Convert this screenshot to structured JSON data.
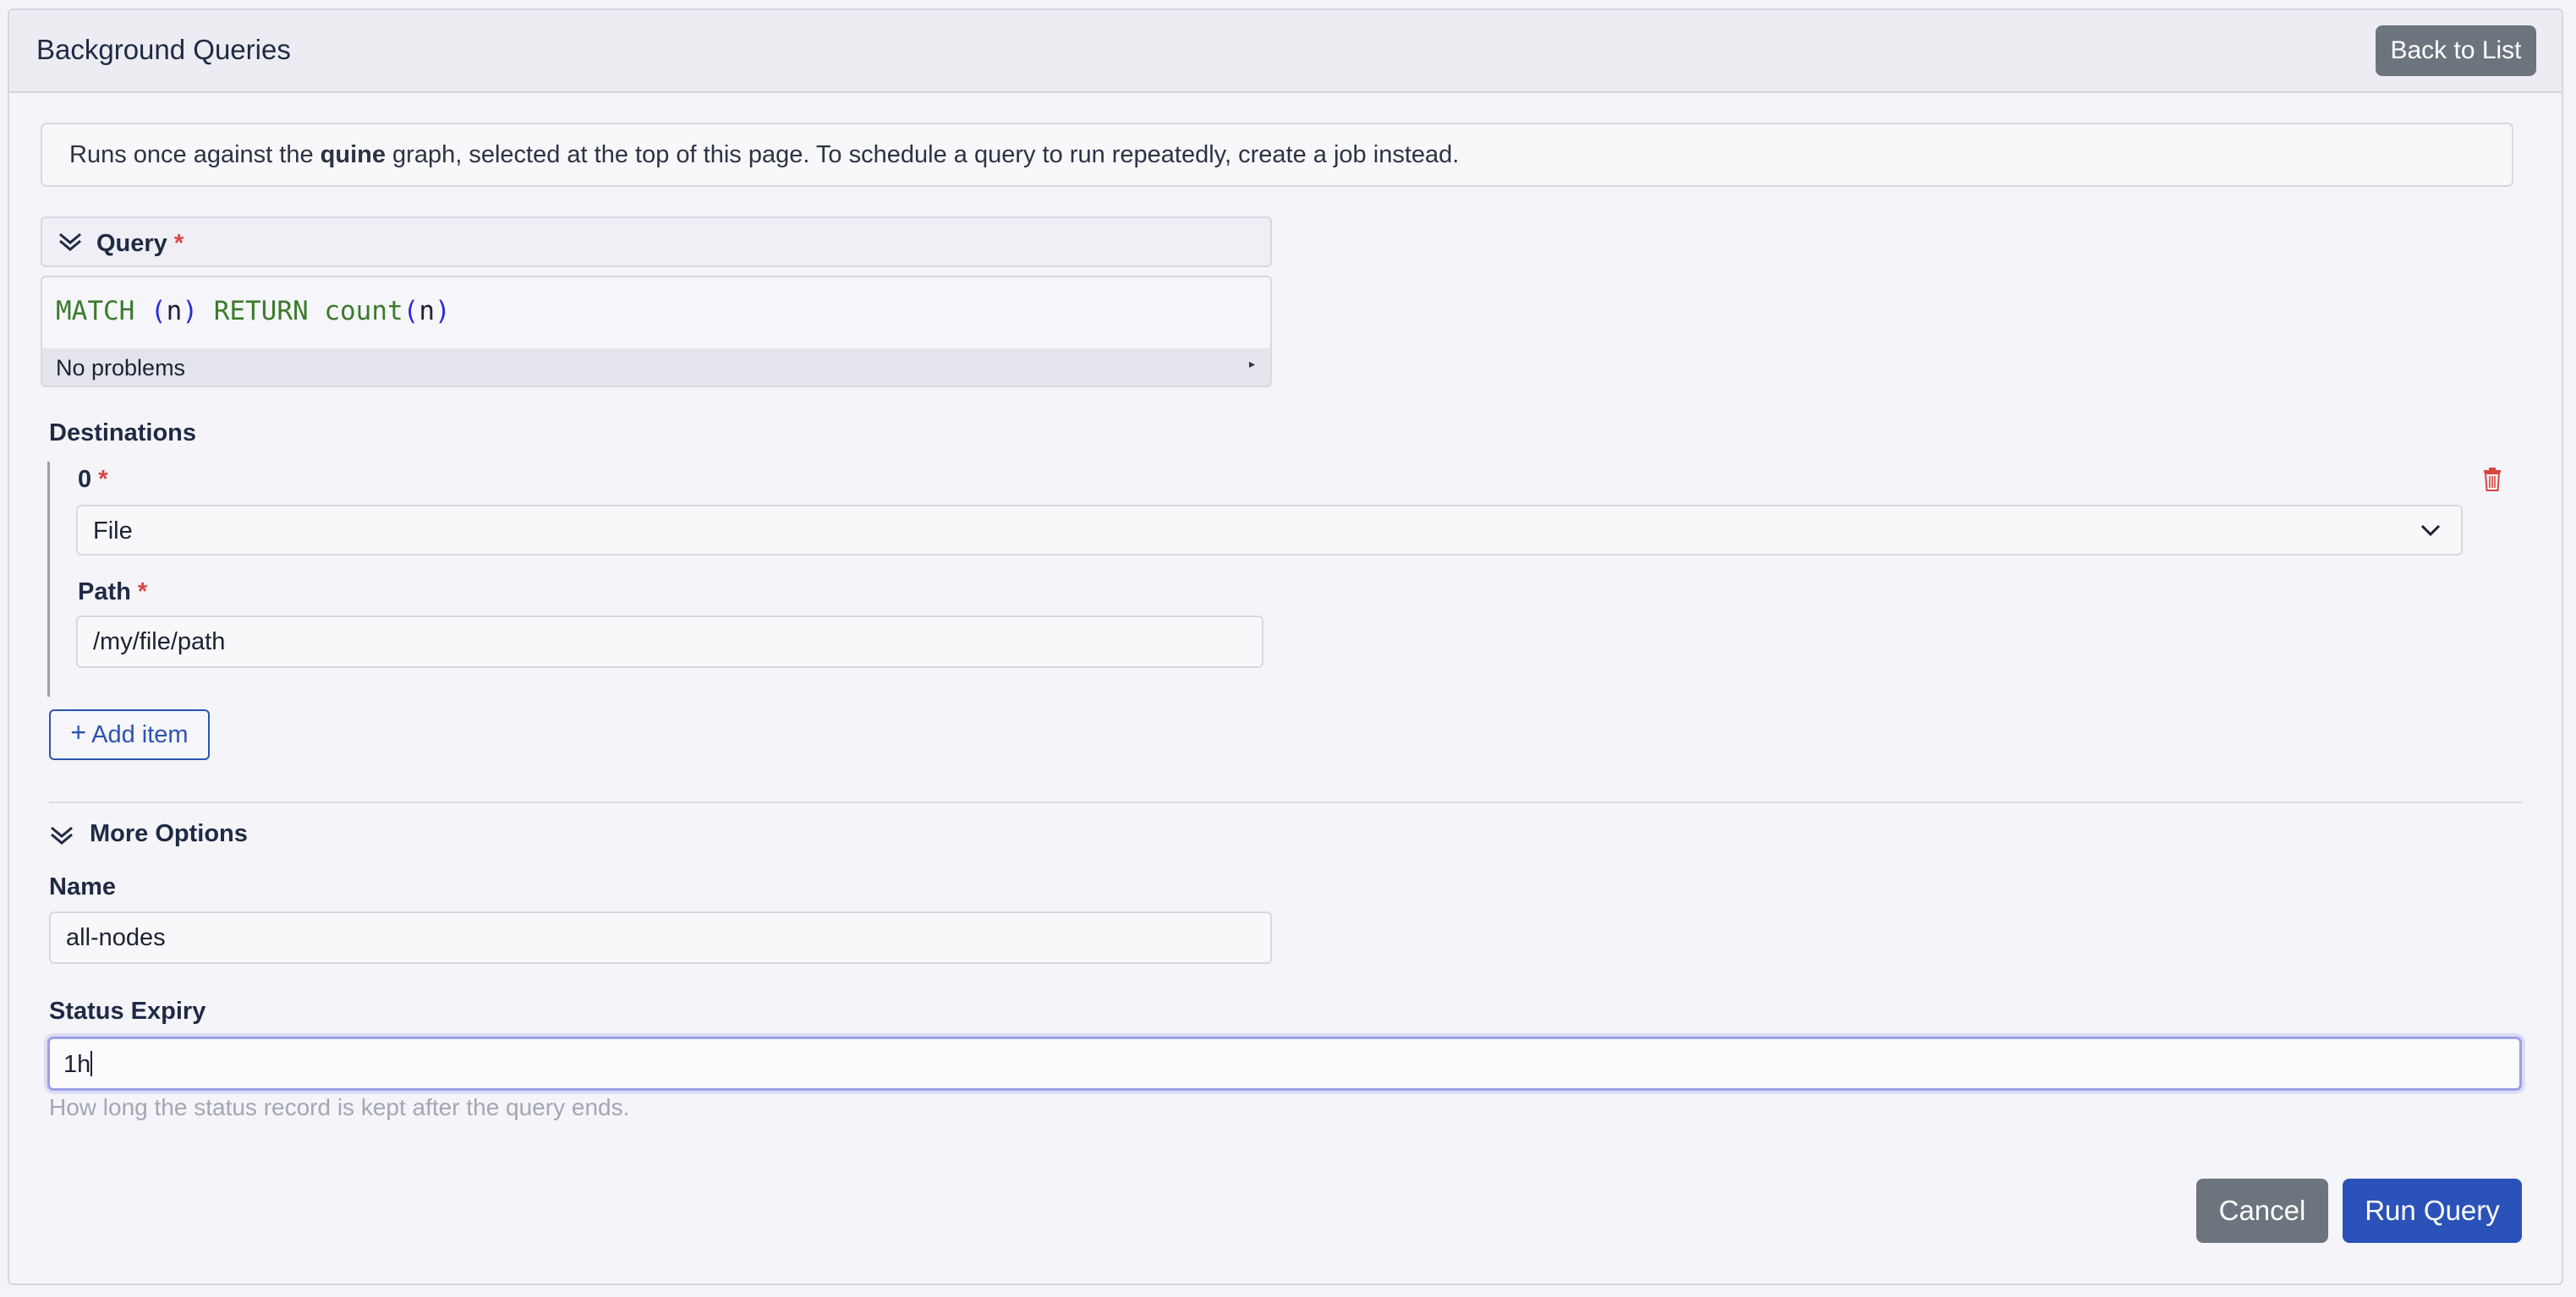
{
  "header": {
    "title": "Background Queries",
    "back_label": "Back to List"
  },
  "info": {
    "prefix": "Runs once against the ",
    "graph": "quine",
    "suffix": " graph, selected at the top of this page. To schedule a query to run repeatedly, create a job instead."
  },
  "query": {
    "label": "Query",
    "required_mark": "*",
    "code": {
      "kw1": "MATCH",
      "open1": "(",
      "var1": "n",
      "close1": ")",
      "kw2": "RETURN",
      "fn": "count",
      "open2": "(",
      "var2": "n",
      "close2": ")"
    },
    "status": "No problems",
    "status_toggle": "▸"
  },
  "destinations": {
    "label": "Destinations",
    "items": [
      {
        "index_label": "0",
        "type_value": "File",
        "path_label": "Path",
        "path_value": "/my/file/path"
      }
    ],
    "add_label": "Add item",
    "add_icon": "+"
  },
  "more_options": {
    "label": "More Options",
    "name_label": "Name",
    "name_value": "all-nodes",
    "expiry_label": "Status Expiry",
    "expiry_value": "1h",
    "expiry_help": "How long the status record is kept after the query ends."
  },
  "actions": {
    "cancel_label": "Cancel",
    "run_label": "Run Query"
  },
  "colors": {
    "primary": "#2a52b8",
    "secondary": "#6c757d",
    "required": "#d9453d",
    "danger": "#d9453d"
  },
  "icons": {
    "query_chevron": "chevron-double-down-icon",
    "more_chevron": "chevron-double-down-icon",
    "select_chevron": "chevron-down-icon",
    "delete": "trash-icon",
    "add": "plus-icon"
  }
}
